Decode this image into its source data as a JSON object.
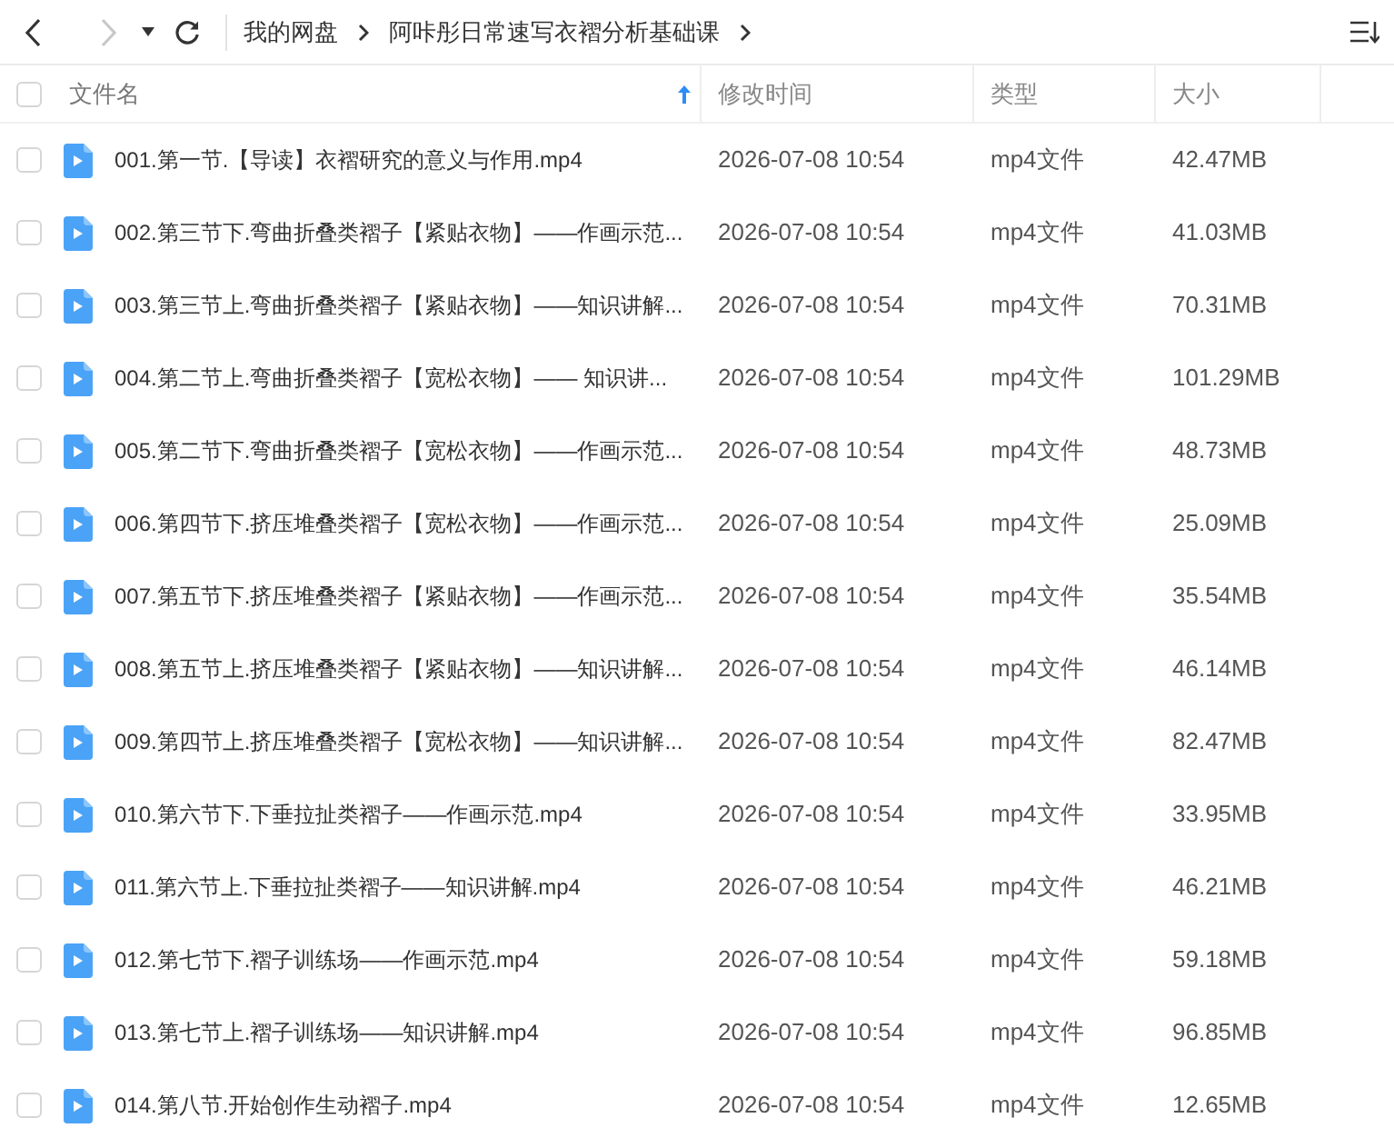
{
  "toolbar": {
    "back": {
      "disabled": false
    },
    "forward": {
      "disabled": true
    },
    "breadcrumb": [
      {
        "label": "我的网盘"
      },
      {
        "label": "阿咔彤日常速写衣褶分析基础课"
      }
    ]
  },
  "table": {
    "select_all": {
      "checked": false
    },
    "columns": [
      {
        "label": "文件名",
        "sorted": true
      },
      {
        "label": "修改时间",
        "sorted": false
      },
      {
        "label": "类型",
        "sorted": false
      },
      {
        "label": "大小",
        "sorted": false
      }
    ],
    "rows": [
      {
        "checked": false,
        "name": "001.第一节.【导读】衣褶研究的意义与作用.mp4",
        "modified": "2026-07-08 10:54",
        "type": "mp4文件",
        "size": "42.47MB"
      },
      {
        "checked": false,
        "name": "002.第三节下.弯曲折叠类褶子【紧贴衣物】——作画示范...",
        "modified": "2026-07-08 10:54",
        "type": "mp4文件",
        "size": "41.03MB"
      },
      {
        "checked": false,
        "name": "003.第三节上.弯曲折叠类褶子【紧贴衣物】——知识讲解...",
        "modified": "2026-07-08 10:54",
        "type": "mp4文件",
        "size": "70.31MB"
      },
      {
        "checked": false,
        "name": "004.第二节上.弯曲折叠类褶子【宽松衣物】—— 知识讲...",
        "modified": "2026-07-08 10:54",
        "type": "mp4文件",
        "size": "101.29MB"
      },
      {
        "checked": false,
        "name": "005.第二节下.弯曲折叠类褶子【宽松衣物】——作画示范...",
        "modified": "2026-07-08 10:54",
        "type": "mp4文件",
        "size": "48.73MB"
      },
      {
        "checked": false,
        "name": "006.第四节下.挤压堆叠类褶子【宽松衣物】——作画示范...",
        "modified": "2026-07-08 10:54",
        "type": "mp4文件",
        "size": "25.09MB"
      },
      {
        "checked": false,
        "name": "007.第五节下.挤压堆叠类褶子【紧贴衣物】——作画示范...",
        "modified": "2026-07-08 10:54",
        "type": "mp4文件",
        "size": "35.54MB"
      },
      {
        "checked": false,
        "name": "008.第五节上.挤压堆叠类褶子【紧贴衣物】——知识讲解...",
        "modified": "2026-07-08 10:54",
        "type": "mp4文件",
        "size": "46.14MB"
      },
      {
        "checked": false,
        "name": "009.第四节上.挤压堆叠类褶子【宽松衣物】——知识讲解...",
        "modified": "2026-07-08 10:54",
        "type": "mp4文件",
        "size": "82.47MB"
      },
      {
        "checked": false,
        "name": "010.第六节下.下垂拉扯类褶子——作画示范.mp4",
        "modified": "2026-07-08 10:54",
        "type": "mp4文件",
        "size": "33.95MB"
      },
      {
        "checked": false,
        "name": "011.第六节上.下垂拉扯类褶子——知识讲解.mp4",
        "modified": "2026-07-08 10:54",
        "type": "mp4文件",
        "size": "46.21MB"
      },
      {
        "checked": false,
        "name": "012.第七节下.褶子训练场——作画示范.mp4",
        "modified": "2026-07-08 10:54",
        "type": "mp4文件",
        "size": "59.18MB"
      },
      {
        "checked": false,
        "name": "013.第七节上.褶子训练场——知识讲解.mp4",
        "modified": "2026-07-08 10:54",
        "type": "mp4文件",
        "size": "96.85MB"
      },
      {
        "checked": false,
        "name": "014.第八节.开始创作生动褶子.mp4",
        "modified": "2026-07-08 10:54",
        "type": "mp4文件",
        "size": "12.65MB"
      }
    ]
  }
}
